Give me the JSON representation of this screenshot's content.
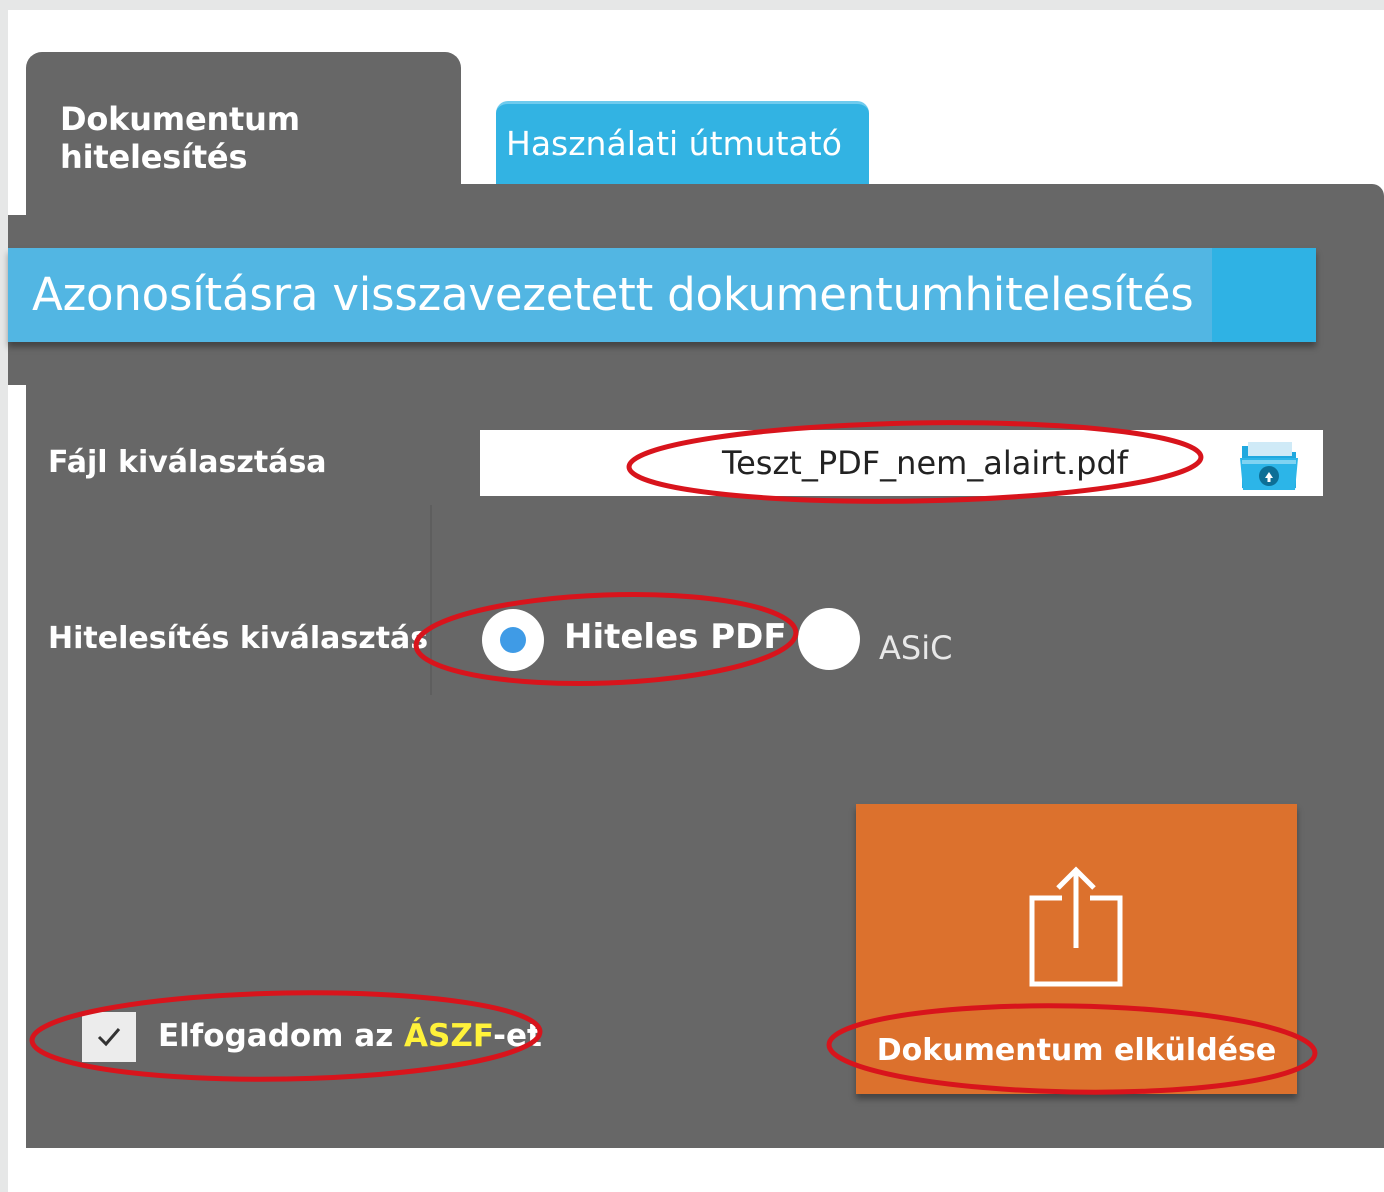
{
  "tabs": {
    "active_label": "Dokumentum hitelesítés",
    "inactive_label": "Használati útmutató"
  },
  "panel": {
    "title": "Azonosításra visszavezetett dokumentumhitelesítés"
  },
  "file_select": {
    "label": "Fájl kiválasztása",
    "value": "Teszt_PDF_nem_alairt.pdf",
    "icon": "folder-upload-icon"
  },
  "auth_select": {
    "label": "Hitelesítés kiválasztás",
    "options": [
      {
        "label": "Hiteles PDF",
        "selected": true
      },
      {
        "label": "ASiC",
        "selected": false
      }
    ]
  },
  "terms": {
    "checked": true,
    "prefix": "Elfogadom az ",
    "link": "ÁSZF",
    "suffix": "-et"
  },
  "send_button": {
    "label": "Dokumentum elküldése",
    "icon": "upload-icon"
  },
  "colors": {
    "panel": "#676767",
    "accent_blue": "#32b3e3",
    "send_orange": "#dc712d",
    "annotation_red": "#d8141c",
    "link_yellow": "#fff23a"
  }
}
